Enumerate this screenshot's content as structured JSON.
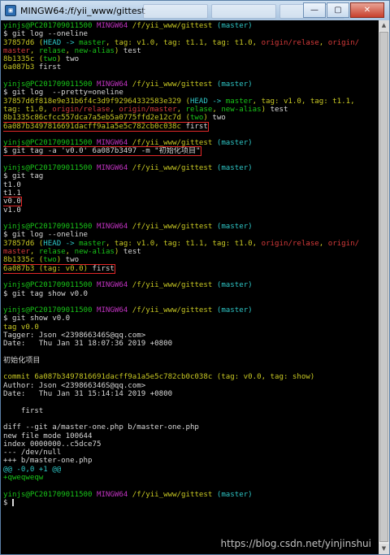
{
  "window": {
    "title": "MINGW64:/f/yii_www/gittest",
    "app_icon_glyph": "▣",
    "minimize_glyph": "—",
    "maximize_glyph": "▢",
    "close_glyph": "✕"
  },
  "prompt": {
    "user": "yinjs@PC201709011500",
    "env": "MINGW64",
    "path": "/f/yii_www/gittest",
    "branch": "(master)",
    "symbol": "$ "
  },
  "lines": [
    {
      "segs": [
        [
          "g",
          "yinjs@PC201709011500"
        ],
        [
          "w",
          " "
        ],
        [
          "m",
          "MINGW64"
        ],
        [
          "w",
          " "
        ],
        [
          "y",
          "/f/yii_www/gittest"
        ],
        [
          "w",
          " "
        ],
        [
          "c",
          "(master)"
        ]
      ]
    },
    {
      "segs": [
        [
          "w",
          "$ git log --oneline"
        ]
      ]
    },
    {
      "segs": [
        [
          "y",
          "37857d6 ("
        ],
        [
          "c",
          "HEAD -> "
        ],
        [
          "g",
          "master"
        ],
        [
          "y",
          ", "
        ],
        [
          "y",
          "tag: v1.0"
        ],
        [
          "y",
          ", "
        ],
        [
          "y",
          "tag: t1.1"
        ],
        [
          "y",
          ", "
        ],
        [
          "y",
          "tag: t1.0"
        ],
        [
          "y",
          ", "
        ],
        [
          "r",
          "origin/relase"
        ],
        [
          "y",
          ", "
        ],
        [
          "r",
          "origin/"
        ]
      ]
    },
    {
      "segs": [
        [
          "r",
          "master"
        ],
        [
          "y",
          ", "
        ],
        [
          "g",
          "relase"
        ],
        [
          "y",
          ", "
        ],
        [
          "g",
          "new-alias"
        ],
        [
          "y",
          ")"
        ],
        [
          "w",
          " test"
        ]
      ]
    },
    {
      "segs": [
        [
          "y",
          "8b1335c ("
        ],
        [
          "g",
          "two"
        ],
        [
          "y",
          ")"
        ],
        [
          "w",
          " two"
        ]
      ]
    },
    {
      "segs": [
        [
          "y",
          "6a087b3"
        ],
        [
          "w",
          " first"
        ]
      ]
    },
    {
      "segs": [
        [
          "w",
          ""
        ]
      ]
    },
    {
      "segs": [
        [
          "g",
          "yinjs@PC201709011500"
        ],
        [
          "w",
          " "
        ],
        [
          "m",
          "MINGW64"
        ],
        [
          "w",
          " "
        ],
        [
          "y",
          "/f/yii_www/gittest"
        ],
        [
          "w",
          " "
        ],
        [
          "c",
          "(master)"
        ]
      ]
    },
    {
      "segs": [
        [
          "w",
          "$ git log  --pretty=oneline"
        ]
      ]
    },
    {
      "segs": [
        [
          "y",
          "37857d6f818e9e31b6f4c3d9f92964332583e329 ("
        ],
        [
          "c",
          "HEAD -> "
        ],
        [
          "g",
          "master"
        ],
        [
          "y",
          ", "
        ],
        [
          "y",
          "tag: v1.0"
        ],
        [
          "y",
          ", "
        ],
        [
          "y",
          "tag: t1.1"
        ],
        [
          "y",
          ","
        ]
      ]
    },
    {
      "segs": [
        [
          "y",
          "tag: t1.0"
        ],
        [
          "y",
          ", "
        ],
        [
          "r",
          "origin/relase"
        ],
        [
          "y",
          ", "
        ],
        [
          "r",
          "origin/master"
        ],
        [
          "y",
          ", "
        ],
        [
          "g",
          "relase"
        ],
        [
          "y",
          ", "
        ],
        [
          "g",
          "new-alias"
        ],
        [
          "y",
          ")"
        ],
        [
          "w",
          " test"
        ]
      ]
    },
    {
      "segs": [
        [
          "y",
          "8b1335c86cfcc557dca7a5eb5a0775ffd2e12c7d ("
        ],
        [
          "g",
          "two"
        ],
        [
          "y",
          ")"
        ],
        [
          "w",
          " two"
        ]
      ]
    },
    {
      "box": true,
      "segs": [
        [
          "y",
          "6a087b3497816691dacff9a1a5e5c782cb0c038c"
        ],
        [
          "w",
          " first"
        ]
      ]
    },
    {
      "segs": [
        [
          "w",
          ""
        ]
      ]
    },
    {
      "segs": [
        [
          "g",
          "yinjs@PC201709011500"
        ],
        [
          "w",
          " "
        ],
        [
          "m",
          "MINGW64"
        ],
        [
          "w",
          " "
        ],
        [
          "y",
          "/f/yii_www/gittest"
        ],
        [
          "w",
          " "
        ],
        [
          "c",
          "(master)"
        ]
      ]
    },
    {
      "box": true,
      "segs": [
        [
          "w",
          "$ git tag -a 'v0.0' 6a087b3497 -m \"初始化项目\""
        ]
      ]
    },
    {
      "segs": [
        [
          "w",
          ""
        ]
      ]
    },
    {
      "segs": [
        [
          "g",
          "yinjs@PC201709011500"
        ],
        [
          "w",
          " "
        ],
        [
          "m",
          "MINGW64"
        ],
        [
          "w",
          " "
        ],
        [
          "y",
          "/f/yii_www/gittest"
        ],
        [
          "w",
          " "
        ],
        [
          "c",
          "(master)"
        ]
      ]
    },
    {
      "segs": [
        [
          "w",
          "$ git tag"
        ]
      ]
    },
    {
      "segs": [
        [
          "w",
          "t1.0"
        ]
      ]
    },
    {
      "segs": [
        [
          "w",
          "t1.1"
        ]
      ]
    },
    {
      "box": true,
      "segs": [
        [
          "w",
          "v0.0"
        ]
      ]
    },
    {
      "segs": [
        [
          "w",
          "v1.0"
        ]
      ]
    },
    {
      "segs": [
        [
          "w",
          ""
        ]
      ]
    },
    {
      "segs": [
        [
          "g",
          "yinjs@PC201709011500"
        ],
        [
          "w",
          " "
        ],
        [
          "m",
          "MINGW64"
        ],
        [
          "w",
          " "
        ],
        [
          "y",
          "/f/yii_www/gittest"
        ],
        [
          "w",
          " "
        ],
        [
          "c",
          "(master)"
        ]
      ]
    },
    {
      "segs": [
        [
          "w",
          "$ git log --oneline"
        ]
      ]
    },
    {
      "segs": [
        [
          "y",
          "37857d6 ("
        ],
        [
          "c",
          "HEAD -> "
        ],
        [
          "g",
          "master"
        ],
        [
          "y",
          ", "
        ],
        [
          "y",
          "tag: v1.0"
        ],
        [
          "y",
          ", "
        ],
        [
          "y",
          "tag: t1.1"
        ],
        [
          "y",
          ", "
        ],
        [
          "y",
          "tag: t1.0"
        ],
        [
          "y",
          ", "
        ],
        [
          "r",
          "origin/relase"
        ],
        [
          "y",
          ", "
        ],
        [
          "r",
          "origin/"
        ]
      ]
    },
    {
      "segs": [
        [
          "r",
          "master"
        ],
        [
          "y",
          ", "
        ],
        [
          "g",
          "relase"
        ],
        [
          "y",
          ", "
        ],
        [
          "g",
          "new-alias"
        ],
        [
          "y",
          ")"
        ],
        [
          "w",
          " test"
        ]
      ]
    },
    {
      "segs": [
        [
          "y",
          "8b1335c ("
        ],
        [
          "g",
          "two"
        ],
        [
          "y",
          ")"
        ],
        [
          "w",
          " two"
        ]
      ]
    },
    {
      "box": true,
      "segs": [
        [
          "y",
          "6a087b3 ("
        ],
        [
          "y",
          "tag: v0.0"
        ],
        [
          "y",
          ")"
        ],
        [
          "w",
          " first"
        ]
      ]
    },
    {
      "segs": [
        [
          "w",
          ""
        ]
      ]
    },
    {
      "segs": [
        [
          "g",
          "yinjs@PC201709011500"
        ],
        [
          "w",
          " "
        ],
        [
          "m",
          "MINGW64"
        ],
        [
          "w",
          " "
        ],
        [
          "y",
          "/f/yii_www/gittest"
        ],
        [
          "w",
          " "
        ],
        [
          "c",
          "(master)"
        ]
      ]
    },
    {
      "segs": [
        [
          "w",
          "$ git tag show v0.0"
        ]
      ]
    },
    {
      "segs": [
        [
          "w",
          ""
        ]
      ]
    },
    {
      "segs": [
        [
          "g",
          "yinjs@PC201709011500"
        ],
        [
          "w",
          " "
        ],
        [
          "m",
          "MINGW64"
        ],
        [
          "w",
          " "
        ],
        [
          "y",
          "/f/yii_www/gittest"
        ],
        [
          "w",
          " "
        ],
        [
          "c",
          "(master)"
        ]
      ]
    },
    {
      "segs": [
        [
          "w",
          "$ git show v0.0"
        ]
      ]
    },
    {
      "segs": [
        [
          "y",
          "tag v0.0"
        ]
      ]
    },
    {
      "segs": [
        [
          "w",
          "Tagger: Json <239866346S@qq.com>"
        ]
      ]
    },
    {
      "segs": [
        [
          "w",
          "Date:   Thu Jan 31 18:07:36 2019 +0800"
        ]
      ]
    },
    {
      "segs": [
        [
          "w",
          ""
        ]
      ]
    },
    {
      "segs": [
        [
          "w",
          "初始化项目"
        ]
      ]
    },
    {
      "segs": [
        [
          "w",
          ""
        ]
      ]
    },
    {
      "segs": [
        [
          "y",
          "commit 6a087b3497816691dacff9a1a5e5c782cb0c038c ("
        ],
        [
          "y",
          "tag: v0.0"
        ],
        [
          "y",
          ", "
        ],
        [
          "y",
          "tag: show"
        ],
        [
          "y",
          ")"
        ]
      ]
    },
    {
      "segs": [
        [
          "w",
          "Author: Json <239866346S@qq.com>"
        ]
      ]
    },
    {
      "segs": [
        [
          "w",
          "Date:   Thu Jan 31 15:14:14 2019 +0800"
        ]
      ]
    },
    {
      "segs": [
        [
          "w",
          ""
        ]
      ]
    },
    {
      "segs": [
        [
          "w",
          "    first"
        ]
      ]
    },
    {
      "segs": [
        [
          "w",
          ""
        ]
      ]
    },
    {
      "segs": [
        [
          "w",
          "diff --git a/master-one.php b/master-one.php"
        ]
      ]
    },
    {
      "segs": [
        [
          "w",
          "new file mode 100644"
        ]
      ]
    },
    {
      "segs": [
        [
          "w",
          "index 0000000..c5dce75"
        ]
      ]
    },
    {
      "segs": [
        [
          "w",
          "--- /dev/null"
        ]
      ]
    },
    {
      "segs": [
        [
          "w",
          "+++ b/master-one.php"
        ]
      ]
    },
    {
      "segs": [
        [
          "c",
          "@@ -0,0 +1 @@"
        ]
      ]
    },
    {
      "segs": [
        [
          "g",
          "+qweqweqw"
        ]
      ]
    },
    {
      "segs": [
        [
          "w",
          ""
        ]
      ]
    },
    {
      "segs": [
        [
          "g",
          "yinjs@PC201709011500"
        ],
        [
          "w",
          " "
        ],
        [
          "m",
          "MINGW64"
        ],
        [
          "w",
          " "
        ],
        [
          "y",
          "/f/yii_www/gittest"
        ],
        [
          "w",
          " "
        ],
        [
          "c",
          "(master)"
        ]
      ]
    },
    {
      "segs": [
        [
          "w",
          "$ "
        ]
      ],
      "cursor": true
    }
  ],
  "colors": {
    "g": "#19c519",
    "m": "#c133c1",
    "y": "#c7c723",
    "c": "#2ec6c6",
    "r": "#d63a3a",
    "w": "#d8d8d8"
  },
  "watermark": "https://blog.csdn.net/yinjinshui"
}
